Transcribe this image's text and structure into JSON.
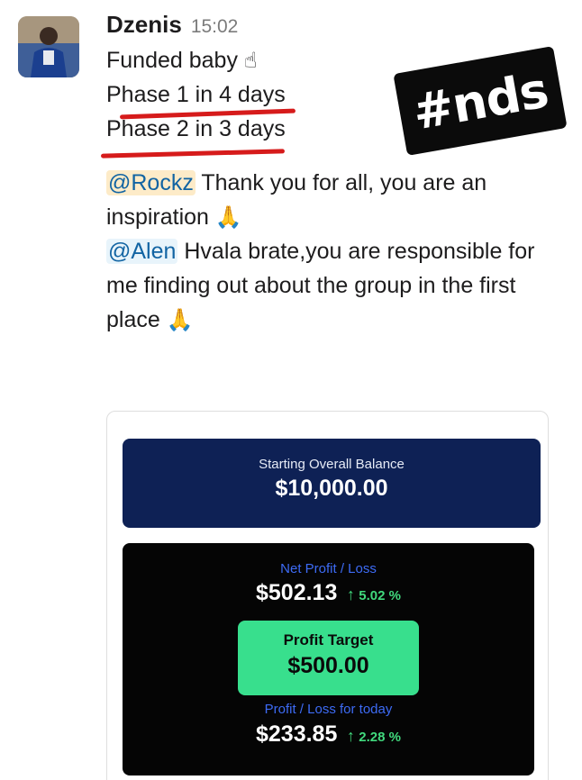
{
  "message": {
    "author": "Dzenis",
    "time": "15:02",
    "line1": "Funded baby",
    "line1_emoji": "☝",
    "line2": "Phase 1 in 4 days",
    "line3": "Phase 2 in 3 days",
    "mention1": "@Rockz",
    "mention1_text": " Thank you for all, you are an",
    "mention1_text2": "inspiration ",
    "pray_emoji": "🙏",
    "mention2": "@Alen",
    "mention2_text": " Hvala brate,you are responsible for",
    "mention2_text2": "me finding out about the group in the first",
    "mention2_text3": "place "
  },
  "sticker": {
    "text": "#nds"
  },
  "dashboard": {
    "starting_label": "Starting Overall Balance",
    "starting_value": "$10,000.00",
    "net_label": "Net Profit / Loss",
    "net_value": "$502.13",
    "net_pct": "5.02 %",
    "target_label": "Profit Target",
    "target_value": "$500.00",
    "today_label": "Profit / Loss for today",
    "today_value": "$233.85",
    "today_pct": "2.28 %",
    "arrow": "↑"
  },
  "colors": {
    "annotation_red": "#d61b1b",
    "balance_navy": "#0e2155",
    "target_green": "#38df8d",
    "mention_blue": "#1264a3"
  }
}
